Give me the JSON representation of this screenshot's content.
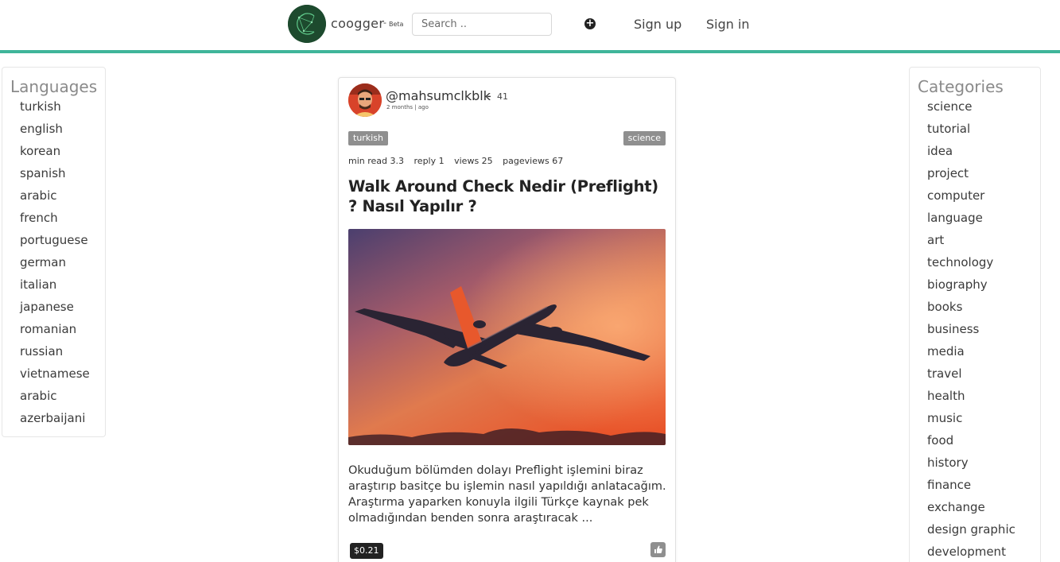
{
  "header": {
    "brand": "coogger",
    "brand_dash": "-",
    "brand_badge": "Beta",
    "search_placeholder": "Search ..",
    "add_icon": "plus-circle-icon",
    "signup_label": "Sign up",
    "signin_label": "Sign in",
    "accent_color": "#3fb59a"
  },
  "languages": {
    "title": "Languages",
    "items": [
      "turkish",
      "english",
      "korean",
      "spanish",
      "arabic",
      "french",
      "portuguese",
      "german",
      "italian",
      "japanese",
      "romanian",
      "russian",
      "vietnamese",
      "arabic",
      "azerbaijani"
    ]
  },
  "categories": {
    "title": "Categories",
    "items": [
      "science",
      "tutorial",
      "idea",
      "project",
      "computer",
      "language",
      "art",
      "technology",
      "biography",
      "books",
      "business",
      "media",
      "travel",
      "health",
      "music",
      "food",
      "history",
      "finance",
      "exchange",
      "design graphic",
      "development"
    ]
  },
  "post": {
    "username": "@mahsumclkblk",
    "dash": "-",
    "reputation": "41",
    "time": "2 months | ago",
    "language_tag": "turkish",
    "category_tag": "science",
    "stats": {
      "min_read": "min read 3.3",
      "reply": "reply 1",
      "views": "views 25",
      "pageviews": "pageviews 67"
    },
    "title": "Walk Around Check Nedir (Preflight) ? Nasıl Yapılır ?",
    "excerpt": "Okuduğum bölümden dolayı Preflight işlemini biraz araştırıp basitçe bu işlemin nasıl yapıldığı anlatacağım. Araştırma yaparken konuyla ilgili Türkçe kaynak pek olmadığından benden sonra araştıracak ...",
    "payout": "$0.21",
    "vote_icon": "thumbs-up-icon"
  }
}
